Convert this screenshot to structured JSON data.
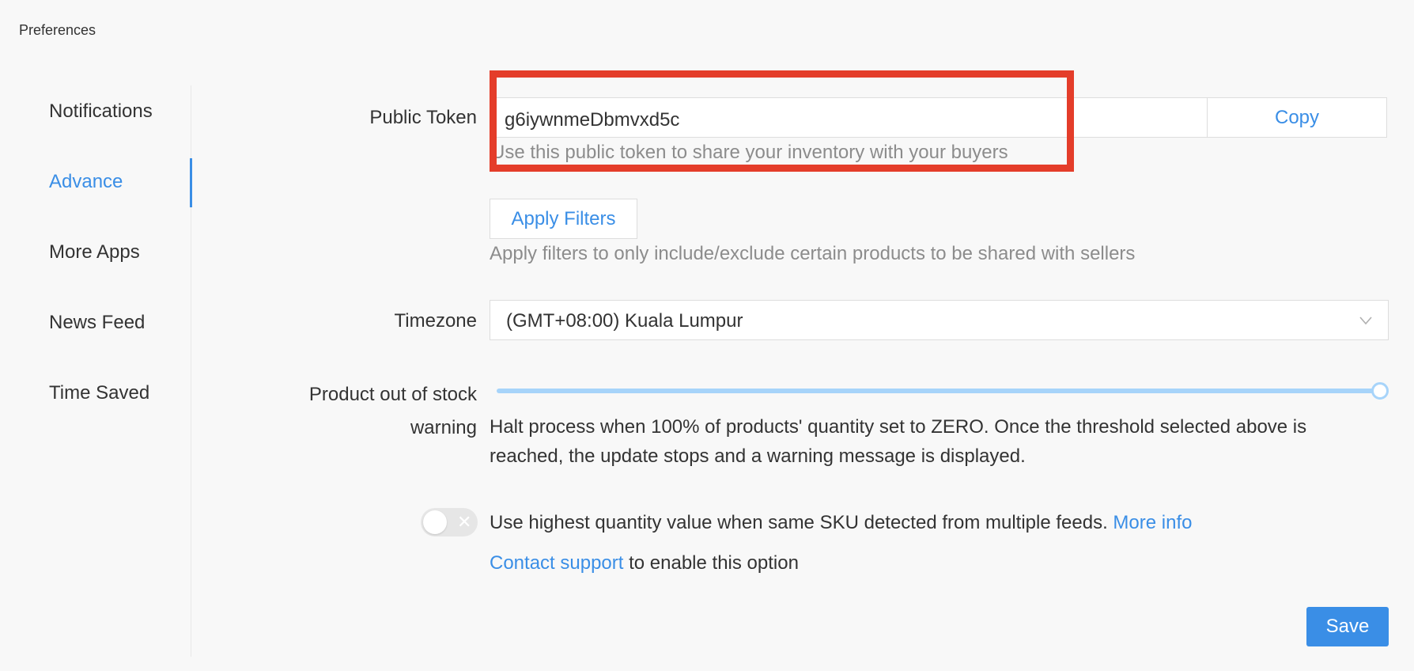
{
  "page": {
    "title": "Preferences"
  },
  "sidebar": {
    "items": [
      {
        "label": "Notifications"
      },
      {
        "label": "Advance"
      },
      {
        "label": "More Apps"
      },
      {
        "label": "News Feed"
      },
      {
        "label": "Time Saved"
      }
    ],
    "active_index": 1
  },
  "public_token": {
    "label": "Public Token",
    "value": "g6iywnmeDbmvxd5c",
    "copy_label": "Copy",
    "help": "Use this public token to share your inventory with your buyers"
  },
  "filters": {
    "button_label": "Apply Filters",
    "help": "Apply filters to only include/exclude certain products to be shared with sellers"
  },
  "timezone": {
    "label": "Timezone",
    "value": "(GMT+08:00) Kuala Lumpur",
    "dropdown_icon": "chevron-down-icon"
  },
  "stock_warning": {
    "label_line1": "Product out of stock",
    "label_line2": "warning",
    "slider_value_percent": 100,
    "desc_line1": "Halt process when 100% of products' quantity set to ZERO. Once the threshold selected above is",
    "desc_line2": "reached, the update stops and a warning message is displayed."
  },
  "highest_qty": {
    "toggle_on": false,
    "toggle_icon": "close-icon",
    "text": "Use highest quantity value when same SKU detected from multiple feeds.",
    "more_info_label": "More info",
    "contact_link": "Contact support",
    "contact_suffix": "to enable this option"
  },
  "save_label": "Save",
  "colors": {
    "accent": "#3a8ee6",
    "highlight_border": "#e43d2a",
    "slider": "#a7d4fa",
    "background": "#f8f8f8"
  }
}
